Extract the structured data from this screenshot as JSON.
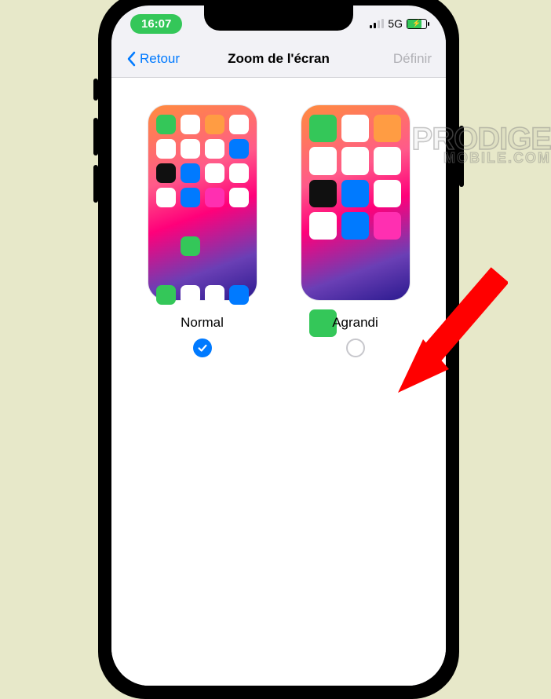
{
  "statusbar": {
    "time": "16:07",
    "network": "5G"
  },
  "navbar": {
    "back_label": "Retour",
    "title": "Zoom de l'écran",
    "action_label": "Définir"
  },
  "options": {
    "normal": {
      "label": "Normal",
      "selected": true
    },
    "zoomed": {
      "label": "Agrandi",
      "selected": false
    }
  },
  "preview_icons_normal": [
    "#34c759",
    "#ffffff",
    "#ff9c43",
    "#ffffff",
    "#ffffff",
    "#ffffff",
    "#ffffff",
    "#007aff",
    "#101010",
    "#007aff",
    "#ffffff",
    "#ffffff",
    "#ffffff",
    "#007aff",
    "#ff2fb1",
    "#ffffff",
    "",
    "",
    "",
    "",
    "",
    "#34c759",
    "",
    "",
    "",
    "",
    "",
    "",
    "#34c759",
    "#ffffff",
    "#ffffff",
    "#007aff"
  ],
  "preview_icons_zoom": [
    "#34c759",
    "#ffffff",
    "#ff9c43",
    "#ffffff",
    "#ffffff",
    "#ffffff",
    "#101010",
    "#007aff",
    "#ffffff",
    "#ffffff",
    "#007aff",
    "#ff2fb1",
    "",
    "",
    "",
    "",
    "",
    "",
    "#34c759",
    "#ffffff",
    "#ffffff"
  ],
  "watermark": {
    "line1": "PRODIGE",
    "line2": "MOBILE.COM"
  }
}
